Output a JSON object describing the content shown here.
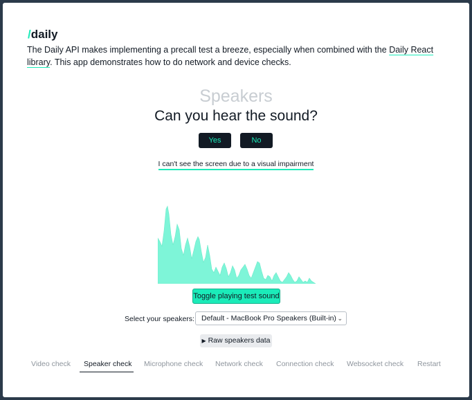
{
  "logo": {
    "slash": "/",
    "name": "daily"
  },
  "intro": {
    "text_before": "The Daily API makes implementing a precall test a breeze, especially when combined with the ",
    "link_text": "Daily React library",
    "text_after": ". This app demonstrates how to do network and device checks."
  },
  "check": {
    "section_title": "Speakers",
    "question": "Can you hear the sound?",
    "yes_label": "Yes",
    "no_label": "No",
    "accessibility_link": "I can't see the screen due to a visual impairment",
    "toggle_label": "Toggle playing test sound",
    "speaker_label": "Select your speakers:",
    "speaker_selected": "Default - MacBook Pro Speakers (Built-in)",
    "raw_label": "Raw speakers data",
    "raw_icon": "triangle-right-icon"
  },
  "colors": {
    "accent": "#1bebb9",
    "waveform": "#7ef5d8",
    "dark": "#121a24",
    "frame": "#2b3a4a"
  },
  "tabs": [
    {
      "label": "Video check",
      "active": false
    },
    {
      "label": "Speaker check",
      "active": true
    },
    {
      "label": "Microphone check",
      "active": false
    },
    {
      "label": "Network check",
      "active": false
    },
    {
      "label": "Connection check",
      "active": false
    },
    {
      "label": "Websocket check",
      "active": false
    },
    {
      "label": "Restart",
      "active": false
    }
  ]
}
